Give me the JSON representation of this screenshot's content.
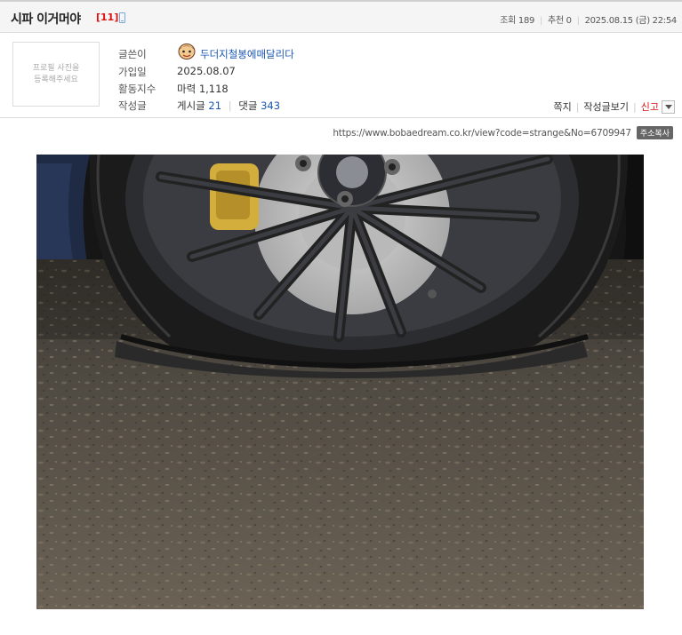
{
  "post": {
    "title": "시파 이거머야",
    "comment_count": "[11]",
    "views_label": "조회",
    "views": "189",
    "recommend_label": "추천",
    "recommend": "0",
    "date": "2025.08.15 (금) 22:54"
  },
  "profile": {
    "avatar_placeholder": "프로필 사진을\n등록해주세요",
    "author_label": "글쓴이",
    "author": "두더지철봉에매달리다",
    "joined_label": "가입일",
    "joined": "2025.08.07",
    "activity_label": "활동지수",
    "activity": "마력 1,118",
    "posts_label": "작성글",
    "posts_text": "게시글",
    "posts_count": "21",
    "comments_text": "댓글",
    "comments_count": "343"
  },
  "actions": {
    "message": "쪽지",
    "view_posts": "작성글보기",
    "report": "신고"
  },
  "url": {
    "text": "https://www.bobaedream.co.kr/view?code=strange&No=6709947",
    "copy_label": "주소복사"
  },
  "image": {
    "icon": "flat-tire-photo"
  }
}
